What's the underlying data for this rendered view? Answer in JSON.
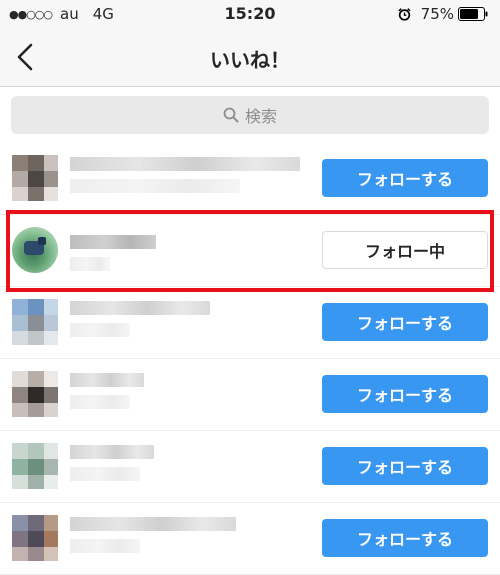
{
  "status_bar": {
    "signal": "●●○○○",
    "carrier": "au",
    "network": "4G",
    "time": "15:20",
    "alarm_icon": "alarm-clock-icon",
    "battery": "75%",
    "battery_icon": "battery-icon"
  },
  "nav": {
    "back_icon": "chevron-left-icon",
    "title": "いいね！"
  },
  "search": {
    "icon": "search-icon",
    "placeholder": "検索"
  },
  "colors": {
    "follow_button": "#3897f0",
    "highlight": "#e8101b",
    "status_bar": "#f7f7f7"
  },
  "users": [
    {
      "button_label": "フォローする",
      "state": "follow"
    },
    {
      "button_label": "フォロー中",
      "state": "following",
      "highlighted": true
    },
    {
      "button_label": "フォローする",
      "state": "follow"
    },
    {
      "button_label": "フォローする",
      "state": "follow"
    },
    {
      "button_label": "フォローする",
      "state": "follow"
    },
    {
      "button_label": "フォローする",
      "state": "follow"
    }
  ]
}
